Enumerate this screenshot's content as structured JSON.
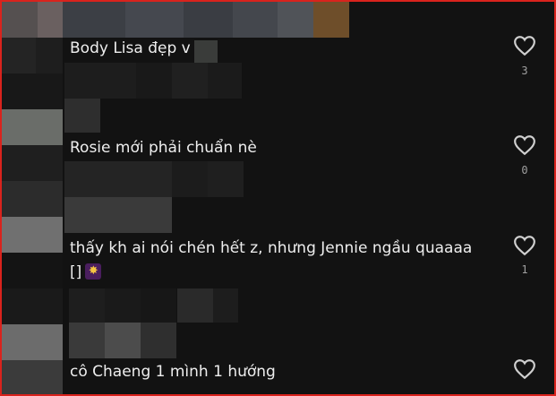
{
  "colors": {
    "frame_border": "#d9231d",
    "background": "#121212",
    "text": "#eeeeee",
    "muted": "#a0a0a0",
    "heart": "#cfcfcf"
  },
  "comments": [
    {
      "text": "Body Lisa đẹp v",
      "like_count": "3"
    },
    {
      "text": "Rosie mới phải chuẩn nè",
      "like_count": "0"
    },
    {
      "text": "thấy kh ai nói chén hết z, nhưng Jennie ngầu quaaaa",
      "text_line2": "[]",
      "emoji": "sparkle-emoji",
      "like_count": "1"
    },
    {
      "text": "cô Chaeng 1 mình 1 hướng",
      "like_count": ""
    }
  ],
  "icons": {
    "like": "heart-icon",
    "avatar": "pixelated-avatar"
  }
}
